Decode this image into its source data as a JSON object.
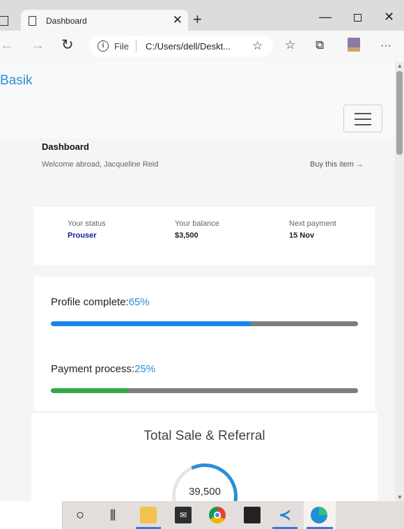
{
  "browser": {
    "tab_title": "Dashboard",
    "new_tab_symbol": "+",
    "tab_close_symbol": "✕",
    "address_scheme": "File",
    "address_url": "C:/Users/dell/Deskt...",
    "icons": [
      "back-icon",
      "forward-icon",
      "reload-icon",
      "info-icon",
      "add-favorite-icon",
      "favorites-icon",
      "collections-icon",
      "profile-icon",
      "more-icon"
    ]
  },
  "navbar": {
    "brand": "Basik"
  },
  "dashboard": {
    "title": "Dashboard",
    "welcome": "Welcome abroad, Jacqueline Reid",
    "buy_link": "Buy this item →"
  },
  "status": {
    "items": [
      {
        "label": "Your status",
        "value": "Prouser"
      },
      {
        "label": "Your balance",
        "value": "$3,500"
      },
      {
        "label": "Next payment",
        "value": "15 Nov"
      }
    ]
  },
  "progress": {
    "profile": {
      "label": "Profile complete:",
      "percent": "65%",
      "value": 0.65,
      "color": "#1a85f0"
    },
    "payment": {
      "label": "Payment process:",
      "percent": "25%",
      "value": 0.25,
      "color": "#2ea84a"
    }
  },
  "sale": {
    "title": "Total Sale & Referral",
    "value": "39,500"
  },
  "taskbar": {
    "icons": [
      "cortana-icon",
      "task-view-icon",
      "file-explorer-icon",
      "mail-icon",
      "chrome-icon",
      "sticky-notes-icon",
      "vscode-icon",
      "edge-icon"
    ]
  }
}
